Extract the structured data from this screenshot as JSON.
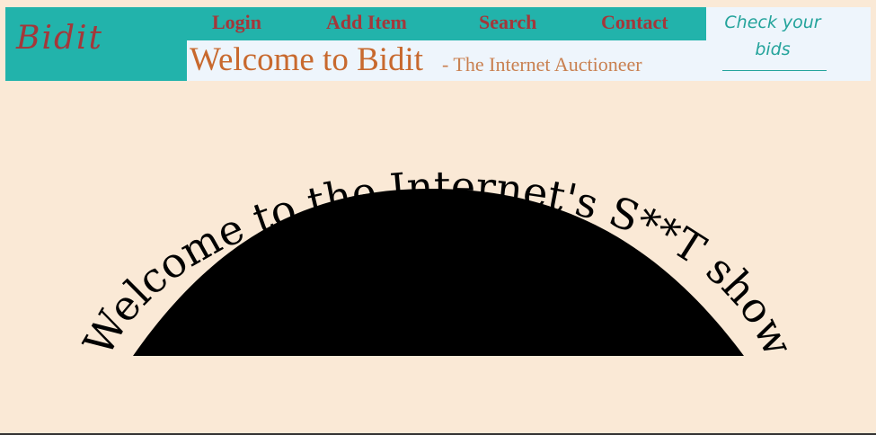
{
  "header": {
    "logo": "Bidit",
    "nav": {
      "login": "Login",
      "add_item": "Add Item",
      "search": "Search",
      "contact": "Contact"
    },
    "welcome_title": "Welcome to Bidit",
    "welcome_subtitle": "- The Internet Auctioneer",
    "check_bids": "Check your bids"
  },
  "hero": {
    "arc_text": "Welcome to the Internet's S**T show"
  },
  "colors": {
    "page_background": "#fae9d6",
    "header_teal": "#22b3ab",
    "nav_text": "#a4373a",
    "title_orange": "#c8692e",
    "band_background": "#eef5fc",
    "hero_shape": "#000000"
  }
}
